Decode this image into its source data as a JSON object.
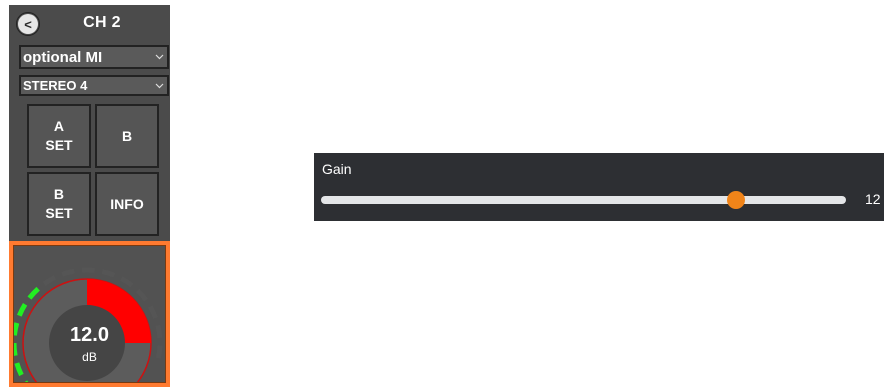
{
  "channel_strip": {
    "back_glyph": "<",
    "title": "CH 2",
    "source_select": "optional MI",
    "output_select": "STEREO 4",
    "pads": [
      {
        "label": "A\nSET"
      },
      {
        "label": "B"
      },
      {
        "label": "B\nSET"
      },
      {
        "label": "INFO"
      }
    ],
    "chevron_icon": "chevron-down-icon"
  },
  "gain_knob": {
    "value_text": "12.0",
    "unit": "dB",
    "level_fraction": 0.5,
    "colors": {
      "active": "#ff0000",
      "led_on": "#22ee22",
      "led_off": "#555555",
      "panel_border": "#ff7a30"
    }
  },
  "gain_slider": {
    "label": "Gain",
    "value": 12,
    "position_fraction": 0.79,
    "readout": "12",
    "colors": {
      "thumb": "#f08419",
      "track": "#e4e6e8"
    }
  }
}
